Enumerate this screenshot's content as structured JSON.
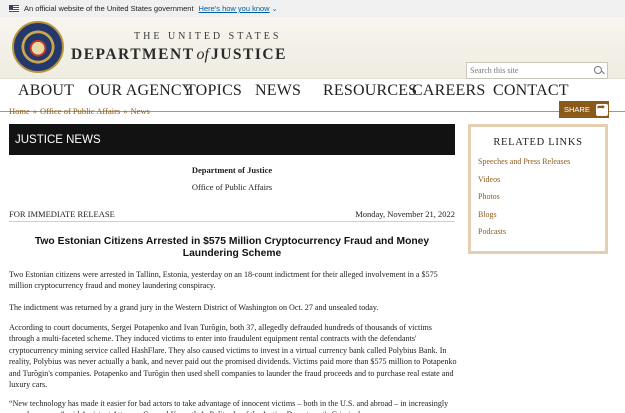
{
  "gov_banner": {
    "text": "An official website of the United States government",
    "link": "Here's how you know",
    "chevron": "⌄"
  },
  "header": {
    "dept_top": "THE UNITED STATES",
    "dept_main_left": "DEPARTMENT",
    "dept_main_of": "of",
    "dept_main_right": "JUSTICE",
    "search_placeholder": "Search this site"
  },
  "nav": {
    "items": [
      "ABOUT",
      "OUR AGENCY",
      "TOPICS",
      "NEWS",
      "RESOURCES",
      "CAREERS",
      "CONTACT"
    ]
  },
  "breadcrumb": {
    "items": [
      "Home",
      "Office of Public Affairs",
      "News"
    ],
    "separator": "»"
  },
  "share_label": "SHARE",
  "main": {
    "section_title": "JUSTICE NEWS",
    "dept_line": "Department of Justice",
    "office_line": "Office of Public Affairs",
    "release_label": "FOR IMMEDIATE RELEASE",
    "release_date": "Monday, November 21, 2022",
    "headline": "Two Estonian Citizens Arrested in $575 Million Cryptocurrency Fraud and Money Laundering Scheme",
    "paragraphs": [
      "Two Estonian citizens were arrested in Tallinn, Estonia, yesterday on an 18-count indictment for their alleged involvement in a $575 million cryptocurrency fraud and money laundering conspiracy.",
      "The indictment was returned by a grand jury in the Western District of Washington on Oct. 27 and unsealed today.",
      "According to court documents, Sergei Potapenko and Ivan Turõgin, both 37, allegedly defrauded hundreds of thousands of victims through a multi-faceted scheme. They induced victims to enter into fraudulent equipment rental contracts with the defendants' cryptocurrency mining service called HashFlare. They also caused victims to invest in a virtual currency bank called Polybius Bank. In reality, Polybius was never actually a bank, and never paid out the promised dividends. Victims paid more than $575 million to Potapenko and Turõgin's companies. Potapenko and Turõgin then used shell companies to launder the fraud proceeds and to purchase real estate and luxury cars.",
      "“New technology has made it easier for bad actors to take advantage of innocent victims – both in the U.S. and abroad – in increasingly complex scams,” said Assistant Attorney General Kenneth A. Polite, Jr. of the Justice Department's Criminal"
    ]
  },
  "sidebar": {
    "title": "RELATED LINKS",
    "links": [
      "Speeches and Press Releases",
      "Videos",
      "Photos",
      "Blogs",
      "Podcasts"
    ]
  }
}
